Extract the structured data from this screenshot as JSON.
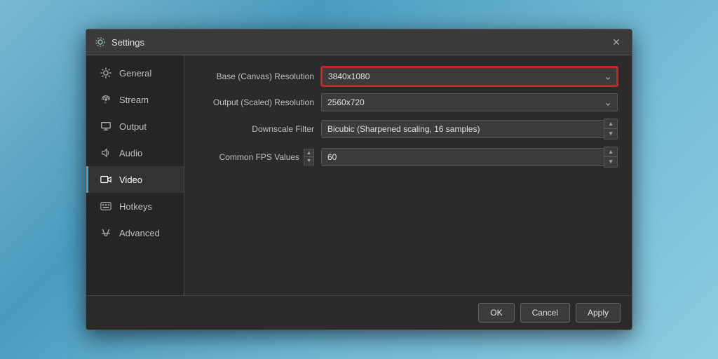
{
  "dialog": {
    "title": "Settings",
    "close_label": "✕"
  },
  "sidebar": {
    "items": [
      {
        "id": "general",
        "label": "General",
        "active": false
      },
      {
        "id": "stream",
        "label": "Stream",
        "active": false
      },
      {
        "id": "output",
        "label": "Output",
        "active": false
      },
      {
        "id": "audio",
        "label": "Audio",
        "active": false
      },
      {
        "id": "video",
        "label": "Video",
        "active": true
      },
      {
        "id": "hotkeys",
        "label": "Hotkeys",
        "active": false
      },
      {
        "id": "advanced",
        "label": "Advanced",
        "active": false
      }
    ]
  },
  "video_settings": {
    "base_resolution_label": "Base (Canvas) Resolution",
    "base_resolution_value": "3840x1080",
    "output_resolution_label": "Output (Scaled) Resolution",
    "output_resolution_value": "2560x720",
    "downscale_filter_label": "Downscale Filter",
    "downscale_filter_value": "Bicubic (Sharpened scaling, 16 samples)",
    "fps_label": "Common FPS Values",
    "fps_value": "60"
  },
  "footer": {
    "ok_label": "OK",
    "cancel_label": "Cancel",
    "apply_label": "Apply"
  },
  "colors": {
    "highlight_border": "#cc2222",
    "active_sidebar": "#4a9fd4"
  }
}
